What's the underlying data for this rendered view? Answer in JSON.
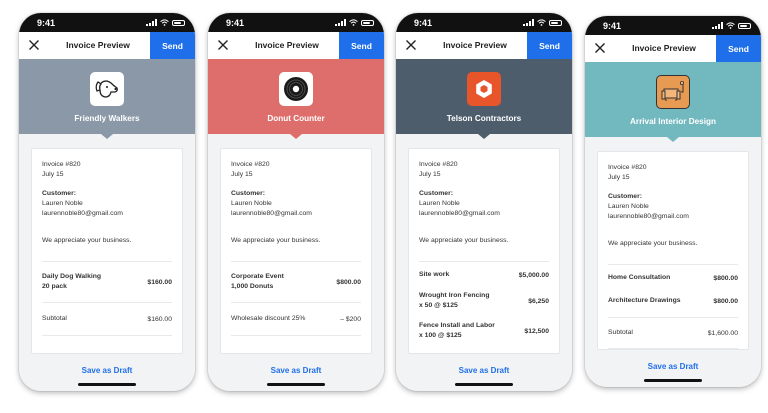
{
  "status_time": "9:41",
  "nav_title": "Invoice Preview",
  "send_label": "Send",
  "draft_label": "Save as Draft",
  "invoice_number": "Invoice #820",
  "invoice_date": "July 15",
  "customer_label": "Customer:",
  "customer_name": "Lauren Noble",
  "customer_email": "laurennoble80@gmail.com",
  "message": "We appreciate your business.",
  "colors": {
    "send_blue": "#1f6fea",
    "friendly_walkers_band": "#8a98a8",
    "donut_counter_band": "#de6e6b",
    "telson_band": "#4e5d6c",
    "telson_logo": "#e8552b",
    "arrival_band": "#72b8bf",
    "arrival_logo": "#e69a52"
  },
  "phones": [
    {
      "business": "Friendly Walkers",
      "logo_icon": "dog-icon",
      "rows": [
        {
          "name": "Daily Dog Walking",
          "sub": "20 pack",
          "price": "$160.00",
          "style": "bold"
        },
        {
          "name": "Subtotal",
          "sub": "",
          "price": "$160.00",
          "style": "plain"
        }
      ]
    },
    {
      "business": "Donut Counter",
      "logo_icon": "donut-icon",
      "rows": [
        {
          "name": "Corporate Event",
          "sub": "1,000 Donuts",
          "price": "$800.00",
          "style": "bold"
        },
        {
          "name": "Wholesale discount 25%",
          "sub": "",
          "price": "– $200",
          "style": "plain"
        }
      ]
    },
    {
      "business": "Telson Contractors",
      "logo_icon": "hexagon-icon",
      "rows": [
        {
          "name": "Site work",
          "sub": "",
          "price": "$5,000.00",
          "style": "bold"
        },
        {
          "name": "Wrought Iron Fencing",
          "sub": "x 50 @ $125",
          "price": "$6,250",
          "style": "bold"
        },
        {
          "name": "Fence Install and Labor",
          "sub": "x 100 @ $125",
          "price": "$12,500",
          "style": "bold"
        }
      ]
    },
    {
      "business": "Arrival Interior Design",
      "logo_icon": "sofa-icon",
      "rows": [
        {
          "name": "Home Consultation",
          "sub": "",
          "price": "$800.00",
          "style": "bold"
        },
        {
          "name": "Architecture Drawings",
          "sub": "",
          "price": "$800.00",
          "style": "bold"
        },
        {
          "name": "Subtotal",
          "sub": "",
          "price": "$1,600.00",
          "style": "plain"
        }
      ]
    }
  ]
}
